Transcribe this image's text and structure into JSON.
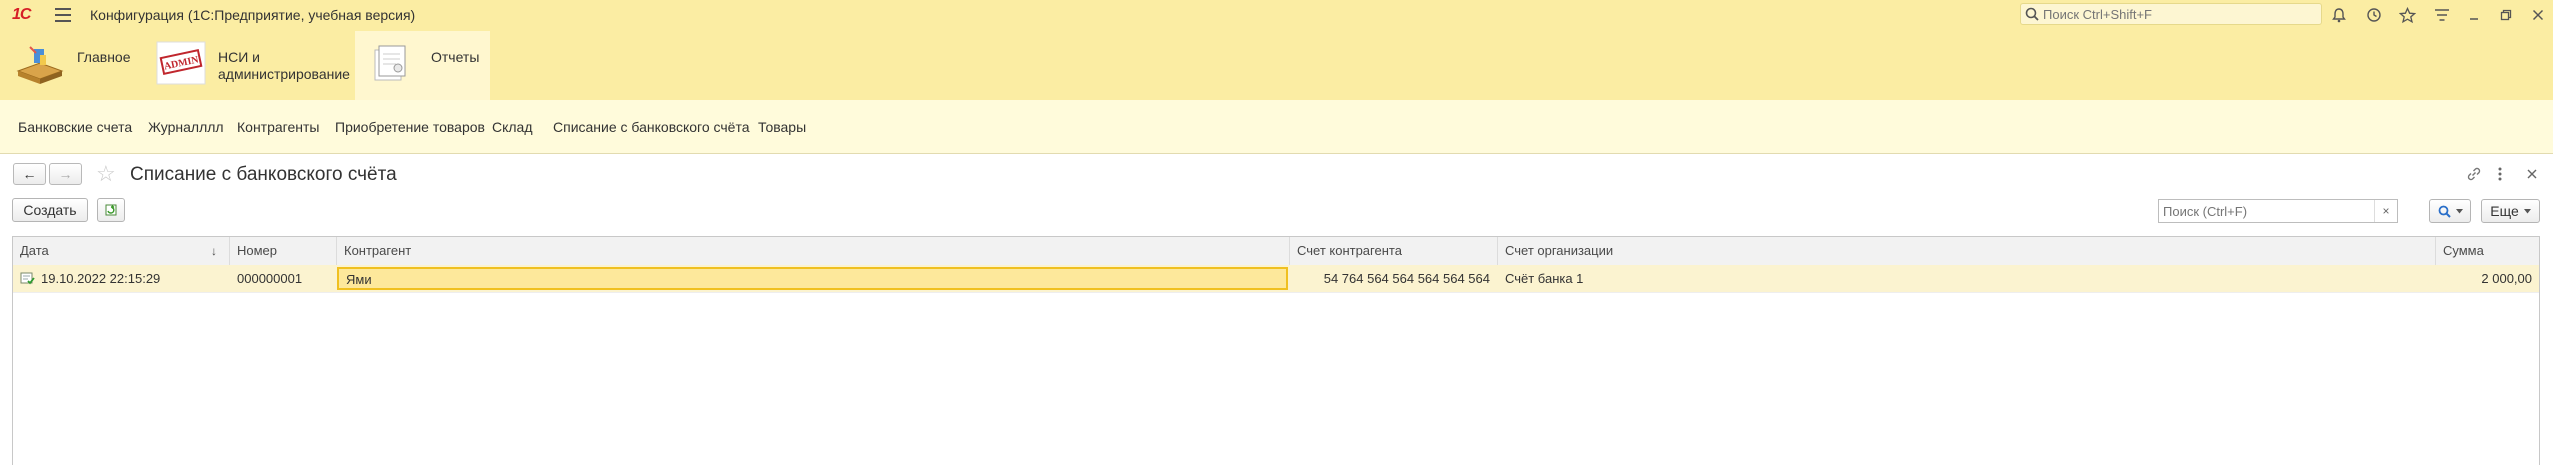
{
  "window": {
    "logo": "1С",
    "title": "Конфигурация  (1С:Предприятие, учебная версия)",
    "search_placeholder": "Поиск Ctrl+Shift+F"
  },
  "sections": [
    {
      "label": "Главное",
      "icon": "home-box-icon"
    },
    {
      "label_line1": "НСИ и",
      "label_line2": "администрирование",
      "icon_text": "ADMIN",
      "icon": "admin-stamp-icon"
    },
    {
      "label": "Отчеты",
      "icon": "reports-icon",
      "active": true
    }
  ],
  "nav": {
    "items": [
      "Банковские счета",
      "Журналллл",
      "Контрагенты",
      "Приобретение товаров",
      "Склад",
      "Списание с банковского счёта",
      "Товары"
    ]
  },
  "form": {
    "back_label": "←",
    "forward_label": "→",
    "title": "Списание с банковского счёта",
    "create_label": "Создать",
    "more_label": "Еще",
    "search_placeholder": "Поиск (Ctrl+F)",
    "clear_label": "×"
  },
  "table": {
    "columns": [
      "Дата",
      "Номер",
      "Контрагент",
      "Счет контрагента",
      "Счет организации",
      "Сумма"
    ],
    "sort_indicator": "↓",
    "rows": [
      {
        "date": "19.10.2022 22:15:29",
        "number": "000000001",
        "counterparty": "Ями",
        "counterparty_account": "54 764 564 564 564 564 564",
        "org_account": "Счёт банка 1",
        "amount": "2 000,00"
      }
    ]
  },
  "colors": {
    "header_bg": "#fbeda3",
    "nav_bg": "#fffbdb",
    "selected_row": "#fbf3d0",
    "active_cell_border": "#f0c020"
  }
}
